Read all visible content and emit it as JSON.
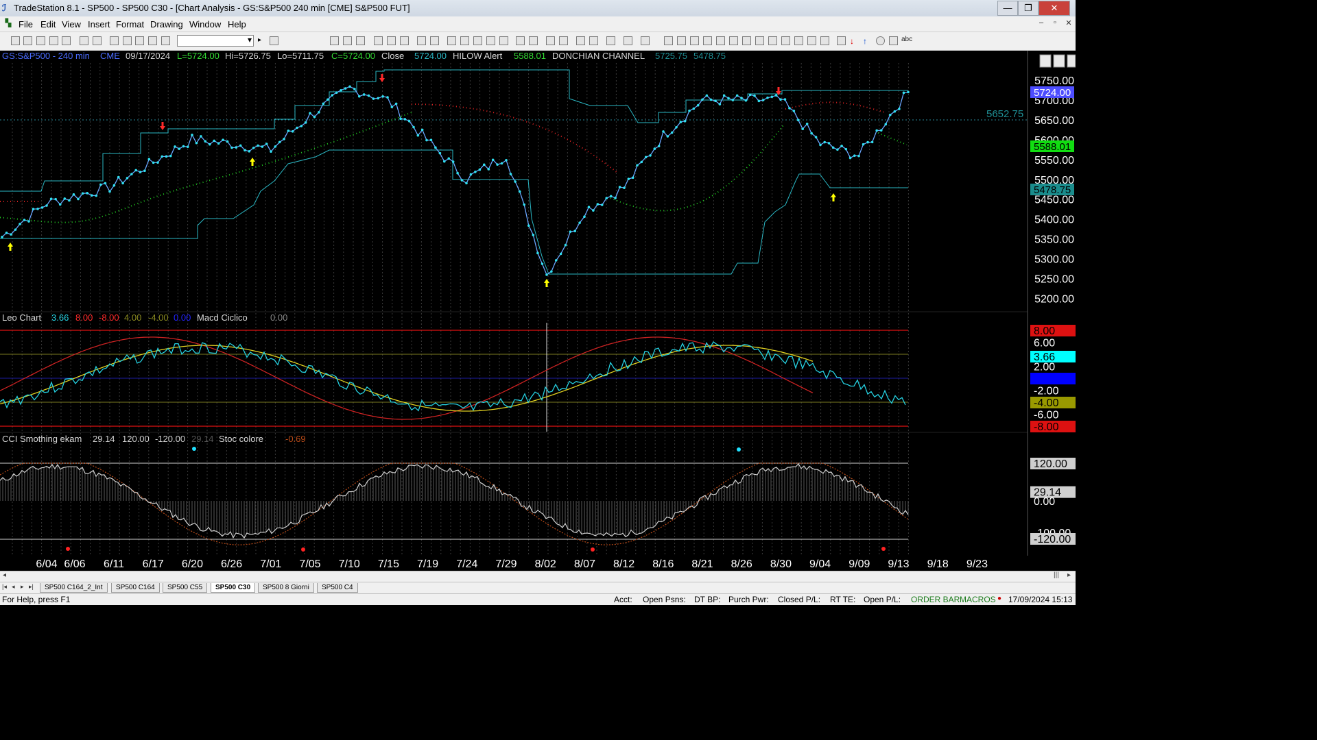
{
  "window": {
    "title": "TradeStation 8.1 - SP500 - SP500 C30 - [Chart Analysis - GS:S&P500  240 min  [CME] S&P500 FUT]",
    "minimize": "—",
    "maximize": "❐",
    "close": "✕"
  },
  "menu": [
    "File",
    "Edit",
    "View",
    "Insert",
    "Format",
    "Drawing",
    "Window",
    "Help"
  ],
  "mdi_controls": [
    "–",
    "▫",
    "✕"
  ],
  "toolbar": {
    "abc_label": "abc"
  },
  "chart": {
    "header": {
      "symbol": "GS:S&P500 - 240 min",
      "exchange": "CME",
      "date": "09/17/2024",
      "low": "L=5724.00",
      "high": "Hi=5726.75",
      "lo": "Lo=5711.75",
      "close_c": "C=5724.00",
      "close_label": "Close",
      "close_val": "5724.00",
      "hilow": "HILOW Alert",
      "hilow_val": "5588.01",
      "donchian": "DONCHIAN CHANNEL",
      "don_hi": "5725.75",
      "don_lo": "5478.75",
      "overlay_price": "5652.75"
    },
    "price_axis": [
      "5750.00",
      "5700.00",
      "5650.00",
      "5600.00",
      "5550.00",
      "5500.00",
      "5450.00",
      "5400.00",
      "5350.00",
      "5300.00",
      "5250.00",
      "5200.00"
    ],
    "price_flags": {
      "close": "5724.00",
      "hilow": "5588.01",
      "don_lo": "5478.75"
    },
    "panel2": {
      "title": "Leo Chart",
      "v1": "3.66",
      "v2": "8.00",
      "v3": "-8.00",
      "v4": "4.00",
      "v5": "-4.00",
      "v6": "0.00",
      "name2": "Macd Ciclico",
      "v7": "0.00",
      "axis": [
        "8.00",
        "6.00",
        "3.66",
        "2.00",
        "0.00",
        "-2.00",
        "-4.00",
        "-6.00",
        "-8.00"
      ]
    },
    "panel3": {
      "title": "CCI Smothing ekam",
      "v1": "29.14",
      "v2": "120.00",
      "v3": "-120.00",
      "v4": "29.14",
      "name2": "Stoc colore",
      "v5": "-0.69",
      "axis": [
        "120.00",
        "29.14",
        "0.00",
        "-100.00",
        "-120.00"
      ]
    },
    "date_axis": [
      "6/04",
      "6/06",
      "6/11",
      "6/17",
      "6/20",
      "6/26",
      "7/01",
      "7/05",
      "7/10",
      "7/15",
      "7/19",
      "7/24",
      "7/29",
      "8/02",
      "8/07",
      "8/12",
      "8/16",
      "8/21",
      "8/26",
      "8/30",
      "9/04",
      "9/09",
      "9/13",
      "9/18",
      "9/23"
    ],
    "colors": {
      "price": "#6aa6ff",
      "channel": "#2ab7c4",
      "up_arrow": "#ffff00",
      "down_arrow": "#ff2a2a",
      "ma_green": "#22cc22",
      "ma_red": "#dd2222",
      "macd_cyan": "#25d0e0",
      "macd_red": "#cc2222",
      "macd_yellow": "#e0d020",
      "cci_white": "#cfcfcf",
      "stoc_brown": "#b84a18"
    }
  },
  "chart_data": {
    "type": "line",
    "title": "GS:S&P500 - 240 min",
    "x": [
      "6/04",
      "6/06",
      "6/11",
      "6/17",
      "6/20",
      "6/26",
      "7/01",
      "7/05",
      "7/10",
      "7/15",
      "7/19",
      "7/24",
      "7/29",
      "8/02",
      "8/07",
      "8/12",
      "8/16",
      "8/21",
      "8/26",
      "8/30",
      "9/04",
      "9/09",
      "9/13"
    ],
    "series": [
      {
        "name": "Close",
        "values": [
          5355,
          5440,
          5480,
          5550,
          5600,
          5590,
          5575,
          5660,
          5730,
          5700,
          5600,
          5500,
          5560,
          5260,
          5420,
          5480,
          5610,
          5700,
          5700,
          5700,
          5590,
          5560,
          5720
        ]
      }
    ],
    "ylim": [
      5150,
      5790
    ]
  },
  "tabs": [
    "SP500 C164_2_Int",
    "SP500 C164",
    "SP500 C55",
    "SP500 C30",
    "SP500 8 Giorni",
    "SP500 C4"
  ],
  "tab_nav": [
    "|◂",
    "◂",
    "▸",
    "▸|"
  ],
  "status": {
    "help": "For Help, press F1",
    "acct": "Acct:",
    "open_psns": "Open Psns:",
    "dt_bp": "DT BP:",
    "purch_pwr": "Purch Pwr:",
    "closed_pl": "Closed P/L:",
    "rt_te": "RT TE:",
    "open_pl": "Open P/L:",
    "order_bar": "ORDER BAR",
    "macros": "MACROS",
    "datetime": "17/09/2024 15:13"
  }
}
